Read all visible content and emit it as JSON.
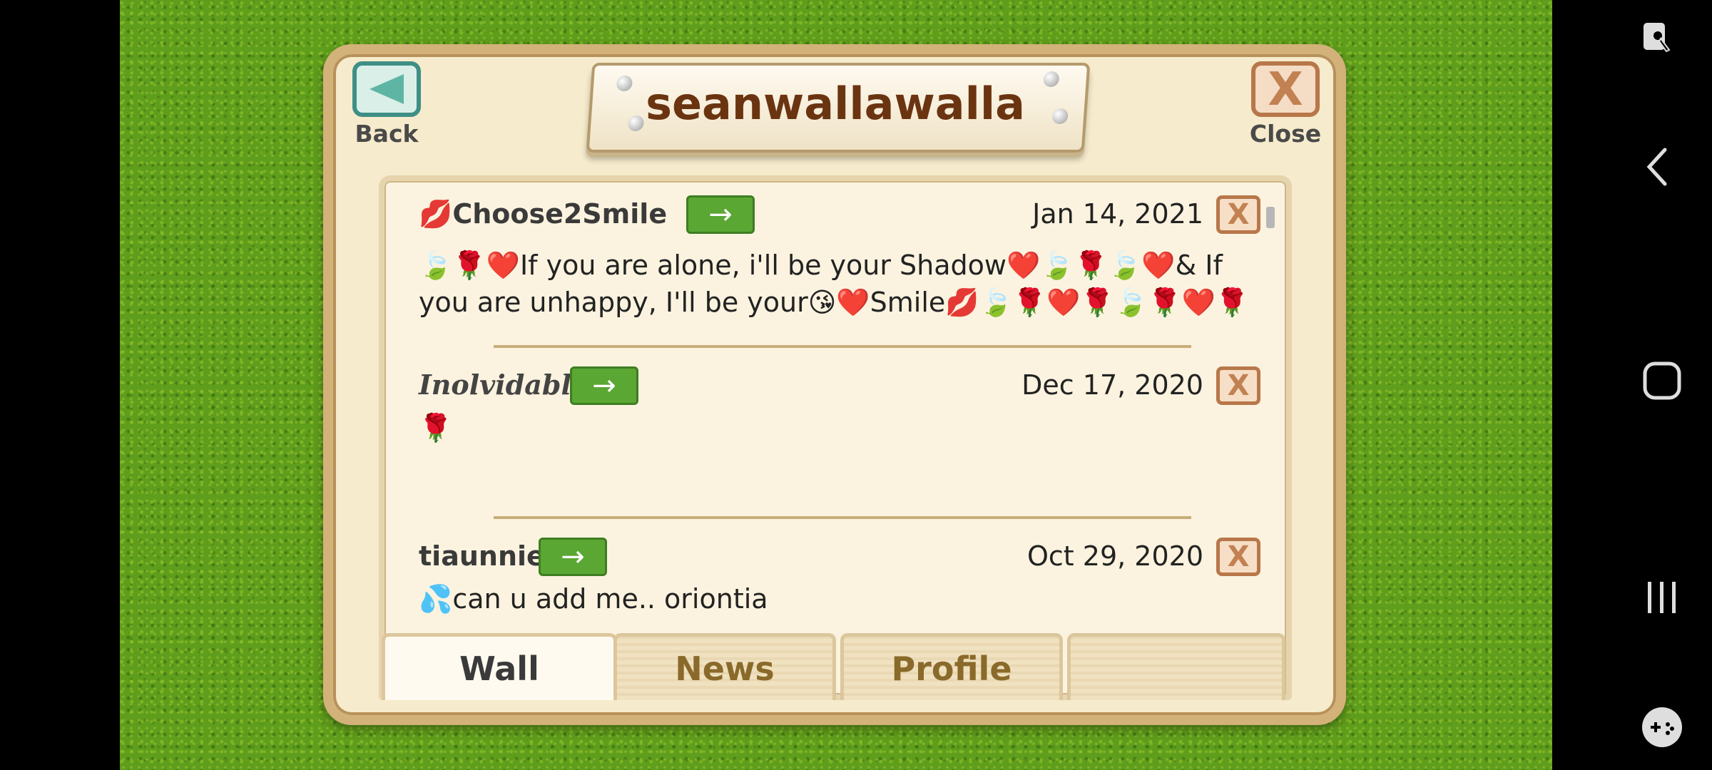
{
  "header": {
    "back_label": "Back",
    "close_label": "Close",
    "title": "seanwallawalla"
  },
  "posts": [
    {
      "author": "💋Choose2Smile",
      "date": "Jan 14, 2021",
      "message": "🍃🌹❤️If you are alone, i'll be your Shadow❤️🍃🌹🍃❤️& If you are unhappy, I'll be your😘❤️Smile💋🍃🌹❤️🌹🍃🌹❤️🌹",
      "delete_label": "X"
    },
    {
      "author": "Inolvidable",
      "date": "Dec 17, 2020",
      "message": "🌹",
      "delete_label": "X"
    },
    {
      "author": "tiaunnie",
      "date": "Oct 29, 2020",
      "message": "💦can u add me.. oriontia",
      "delete_label": "X"
    }
  ],
  "tabs": {
    "wall": "Wall",
    "news": "News",
    "profile": "Profile",
    "blank": ""
  },
  "icons": {
    "goto": "→",
    "back": "◀",
    "nav_back": "‹"
  },
  "colors": {
    "grass": "#5f9d1c",
    "panel": "#f6ebcc",
    "title_text": "#6b3411",
    "go_button": "#5aa733"
  }
}
